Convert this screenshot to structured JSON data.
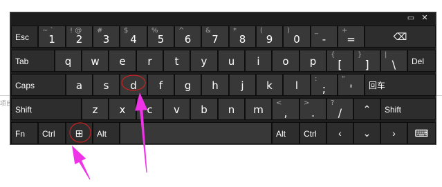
{
  "background": {
    "side_text": "项目"
  },
  "window_controls": {
    "minimize": "▭",
    "close": "✕"
  },
  "rows": [
    [
      {
        "id": "esc",
        "main": "Esc",
        "alt": ""
      },
      {
        "id": "1",
        "main": "1",
        "alt": "~ `"
      },
      {
        "id": "2",
        "main": "2",
        "alt": "! @"
      },
      {
        "id": "3",
        "main": "3",
        "alt": "#"
      },
      {
        "id": "4",
        "main": "4",
        "alt": "$"
      },
      {
        "id": "5",
        "main": "5",
        "alt": "%"
      },
      {
        "id": "6",
        "main": "6",
        "alt": "^"
      },
      {
        "id": "7",
        "main": "7",
        "alt": "&"
      },
      {
        "id": "8",
        "main": "8",
        "alt": "*"
      },
      {
        "id": "9",
        "main": "9",
        "alt": "("
      },
      {
        "id": "0",
        "main": "0",
        "alt": ")"
      },
      {
        "id": "minus",
        "main": "-",
        "alt": "_"
      },
      {
        "id": "equals",
        "main": "=",
        "alt": "+"
      },
      {
        "id": "backspace",
        "main": "",
        "alt": "",
        "icon": "backspace-icon",
        "glyph": "⌫"
      }
    ],
    [
      {
        "id": "tab",
        "main": "Tab",
        "alt": ""
      },
      {
        "id": "q",
        "main": "q",
        "alt": ""
      },
      {
        "id": "w",
        "main": "w",
        "alt": ""
      },
      {
        "id": "e",
        "main": "e",
        "alt": ""
      },
      {
        "id": "r",
        "main": "r",
        "alt": ""
      },
      {
        "id": "t",
        "main": "t",
        "alt": ""
      },
      {
        "id": "y",
        "main": "y",
        "alt": ""
      },
      {
        "id": "u",
        "main": "u",
        "alt": ""
      },
      {
        "id": "i",
        "main": "i",
        "alt": ""
      },
      {
        "id": "o",
        "main": "o",
        "alt": ""
      },
      {
        "id": "p",
        "main": "p",
        "alt": ""
      },
      {
        "id": "lbracket",
        "main": "[",
        "alt": "{"
      },
      {
        "id": "rbracket",
        "main": "]",
        "alt": "}"
      },
      {
        "id": "backslash",
        "main": "\\",
        "alt": "|"
      },
      {
        "id": "del",
        "main": "Del",
        "alt": ""
      }
    ],
    [
      {
        "id": "caps",
        "main": "Caps",
        "alt": ""
      },
      {
        "id": "a",
        "main": "a",
        "alt": ""
      },
      {
        "id": "s",
        "main": "s",
        "alt": ""
      },
      {
        "id": "d",
        "main": "d",
        "alt": ""
      },
      {
        "id": "f",
        "main": "f",
        "alt": ""
      },
      {
        "id": "g",
        "main": "g",
        "alt": ""
      },
      {
        "id": "h",
        "main": "h",
        "alt": ""
      },
      {
        "id": "j",
        "main": "j",
        "alt": ""
      },
      {
        "id": "k",
        "main": "k",
        "alt": ""
      },
      {
        "id": "l",
        "main": "l",
        "alt": ""
      },
      {
        "id": "semicolon",
        "main": ";",
        "alt": ":"
      },
      {
        "id": "quote",
        "main": "'",
        "alt": "\""
      },
      {
        "id": "enter",
        "main": "回车",
        "alt": ""
      }
    ],
    [
      {
        "id": "lshift",
        "main": "Shift",
        "alt": ""
      },
      {
        "id": "z",
        "main": "z",
        "alt": ""
      },
      {
        "id": "x",
        "main": "x",
        "alt": ""
      },
      {
        "id": "c",
        "main": "c",
        "alt": ""
      },
      {
        "id": "v",
        "main": "v",
        "alt": ""
      },
      {
        "id": "b",
        "main": "b",
        "alt": ""
      },
      {
        "id": "n",
        "main": "n",
        "alt": ""
      },
      {
        "id": "m",
        "main": "m",
        "alt": ""
      },
      {
        "id": "comma",
        "main": ",",
        "alt": "<"
      },
      {
        "id": "period",
        "main": ".",
        "alt": ">"
      },
      {
        "id": "slash",
        "main": "/",
        "alt": "?"
      },
      {
        "id": "up",
        "main": "",
        "alt": "",
        "icon": "arrow-up-icon",
        "glyph": "⌃"
      },
      {
        "id": "rshift",
        "main": "Shift",
        "alt": ""
      }
    ],
    [
      {
        "id": "fn",
        "main": "Fn",
        "alt": ""
      },
      {
        "id": "lctrl",
        "main": "Ctrl",
        "alt": ""
      },
      {
        "id": "win",
        "main": "",
        "alt": "",
        "icon": "windows-logo-icon",
        "glyph": "⊞"
      },
      {
        "id": "lalt",
        "main": "Alt",
        "alt": ""
      },
      {
        "id": "space",
        "main": "",
        "alt": ""
      },
      {
        "id": "ralt",
        "main": "Alt",
        "alt": ""
      },
      {
        "id": "rctrl",
        "main": "Ctrl",
        "alt": ""
      },
      {
        "id": "left",
        "main": "",
        "alt": "",
        "icon": "arrow-left-icon",
        "glyph": "‹"
      },
      {
        "id": "down",
        "main": "",
        "alt": "",
        "icon": "arrow-down-icon",
        "glyph": "⌄"
      },
      {
        "id": "right",
        "main": "",
        "alt": "",
        "icon": "arrow-right-icon",
        "glyph": "›"
      },
      {
        "id": "kbd",
        "main": "",
        "alt": "",
        "icon": "keyboard-settings-icon",
        "glyph": "⌨"
      }
    ]
  ],
  "annotation_color": "#ee34e6"
}
